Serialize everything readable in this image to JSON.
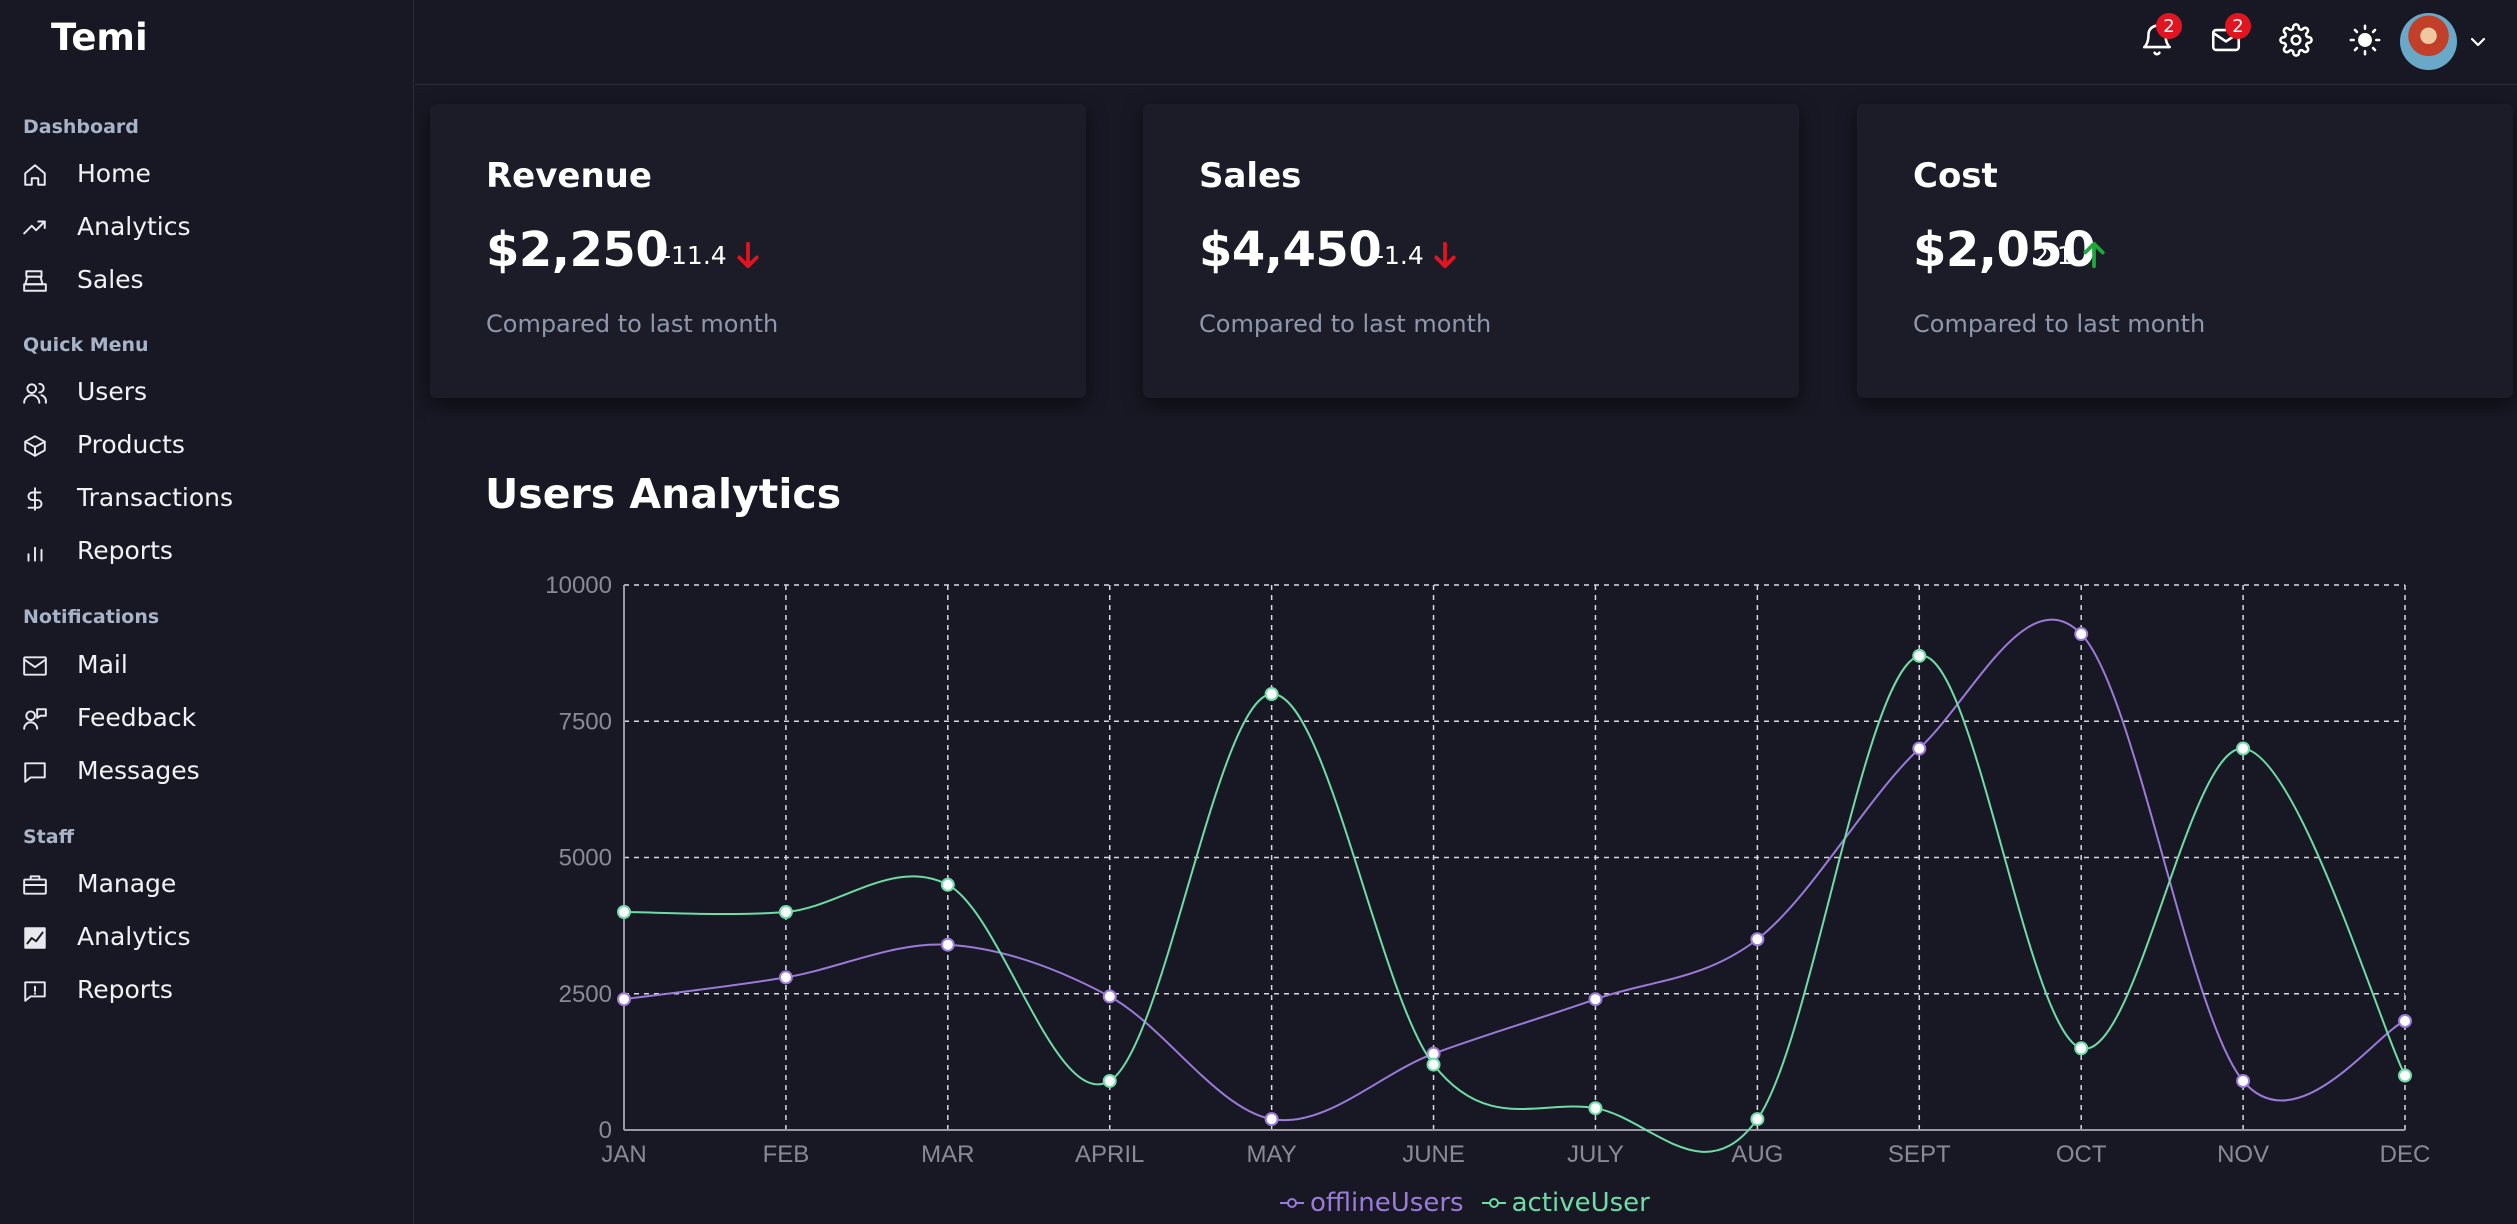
{
  "app": {
    "title": "Temi"
  },
  "sidebar": {
    "sections": [
      {
        "title": "Dashboard",
        "items": [
          {
            "label": "Home",
            "icon": "home-icon"
          },
          {
            "label": "Analytics",
            "icon": "trending-up-icon"
          },
          {
            "label": "Sales",
            "icon": "cash-register-icon"
          }
        ]
      },
      {
        "title": "Quick Menu",
        "items": [
          {
            "label": "Users",
            "icon": "users-icon"
          },
          {
            "label": "Products",
            "icon": "box-icon"
          },
          {
            "label": "Transactions",
            "icon": "dollar-icon"
          },
          {
            "label": "Reports",
            "icon": "bar-chart-icon"
          }
        ]
      },
      {
        "title": "Notifications",
        "items": [
          {
            "label": "Mail",
            "icon": "mail-icon"
          },
          {
            "label": "Feedback",
            "icon": "feedback-icon"
          },
          {
            "label": "Messages",
            "icon": "message-icon"
          }
        ]
      },
      {
        "title": "Staff",
        "items": [
          {
            "label": "Manage",
            "icon": "briefcase-icon"
          },
          {
            "label": "Analytics",
            "icon": "analytics-chart-icon"
          },
          {
            "label": "Reports",
            "icon": "report-icon"
          }
        ]
      }
    ]
  },
  "topbar": {
    "notifications_count": "2",
    "mail_count": "2",
    "icons": [
      "bell-icon",
      "mail-icon",
      "gear-icon",
      "sun-icon",
      "avatar",
      "chevron-down-icon"
    ]
  },
  "cards": [
    {
      "title": "Revenue",
      "value": "$2,250",
      "change": "-11.4",
      "direction": "down",
      "subtitle": "Compared to last month"
    },
    {
      "title": "Sales",
      "value": "$4,450",
      "change": "-1.4",
      "direction": "down",
      "subtitle": "Compared to last month"
    },
    {
      "title": "Cost",
      "value": "$2,050",
      "change": "2.1",
      "direction": "up",
      "subtitle": "Compared to last month"
    }
  ],
  "colors": {
    "down": "#e0151f",
    "up": "#1fa83a",
    "offlineUsers": "#9b7ad8",
    "activeUser": "#6fdca6"
  },
  "chart_data": {
    "type": "line",
    "title": "Users Analytics",
    "categories": [
      "JAN",
      "FEB",
      "MAR",
      "APRIL",
      "MAY",
      "JUNE",
      "JULY",
      "AUG",
      "SEPT",
      "OCT",
      "NOV",
      "DEC"
    ],
    "series": [
      {
        "name": "offlineUsers",
        "values": [
          2400,
          2800,
          3400,
          2450,
          200,
          1400,
          2400,
          3500,
          7000,
          9100,
          900,
          2000
        ]
      },
      {
        "name": "activeUser",
        "values": [
          4000,
          4000,
          4500,
          900,
          8000,
          1200,
          400,
          200,
          8700,
          1500,
          7000,
          1000
        ]
      }
    ],
    "yticks": [
      "0",
      "2500",
      "5000",
      "7500",
      "10000"
    ],
    "ylim": [
      0,
      10000
    ],
    "grid": true,
    "legend": "bottom-center"
  }
}
